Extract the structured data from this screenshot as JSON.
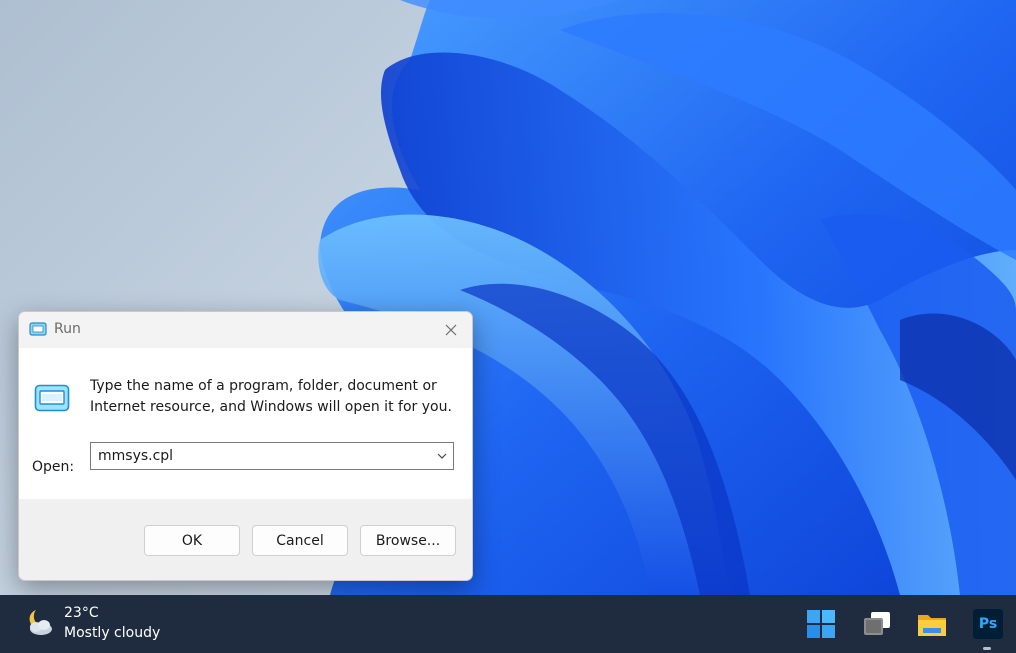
{
  "dialog": {
    "title": "Run",
    "description_line1": "Type the name of a program, folder, document or",
    "description_line2": "Internet resource, and Windows will open it for you.",
    "open_label": "Open:",
    "open_value": "mmsys.cpl",
    "ok_label": "OK",
    "cancel_label": "Cancel",
    "browse_label": "Browse..."
  },
  "taskbar": {
    "weather_temp": "23°C",
    "weather_desc": "Mostly cloudy",
    "icons": [
      "windows-start-icon",
      "task-view-icon",
      "file-explorer-icon",
      "photoshop-icon"
    ],
    "photoshop_text": "Ps"
  },
  "colors": {
    "taskbar_bg": "#1f2b3f",
    "wallpaper_blue": "#1a5cf0",
    "dialog_bg": "#f0f0f0"
  }
}
